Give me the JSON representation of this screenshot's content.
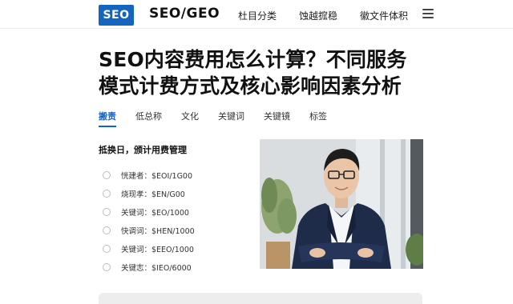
{
  "header": {
    "logo": "SEO",
    "brand": "SEO/GEO",
    "nav": [
      "杜目分类",
      "蚀越搲稳",
      "徽文件体积"
    ]
  },
  "article": {
    "title_line1": "SEO内容费用怎么计算？不同服务",
    "title_line2": "模式计费方式及核心影响因素分析"
  },
  "tabs": [
    "搬责",
    "低总称",
    "文化",
    "关键词",
    "关键镜",
    "标签"
  ],
  "active_tab": 0,
  "section": {
    "heading": "抵换日，颁计用费管理",
    "items": [
      "恍建者：$EOI/1G00",
      "烧现孝：$EN/G00",
      "关键词：$EO/1000",
      "快调词：$HEN/1000",
      "关键词：$EEO/1000",
      "关键志：$IEO/6000"
    ]
  },
  "colors": {
    "accent": "#1565c0",
    "suit": "#1e2c4a"
  },
  "icons": {
    "menu": "hamburger-icon",
    "list_bullet": "radio-circle-icon"
  }
}
